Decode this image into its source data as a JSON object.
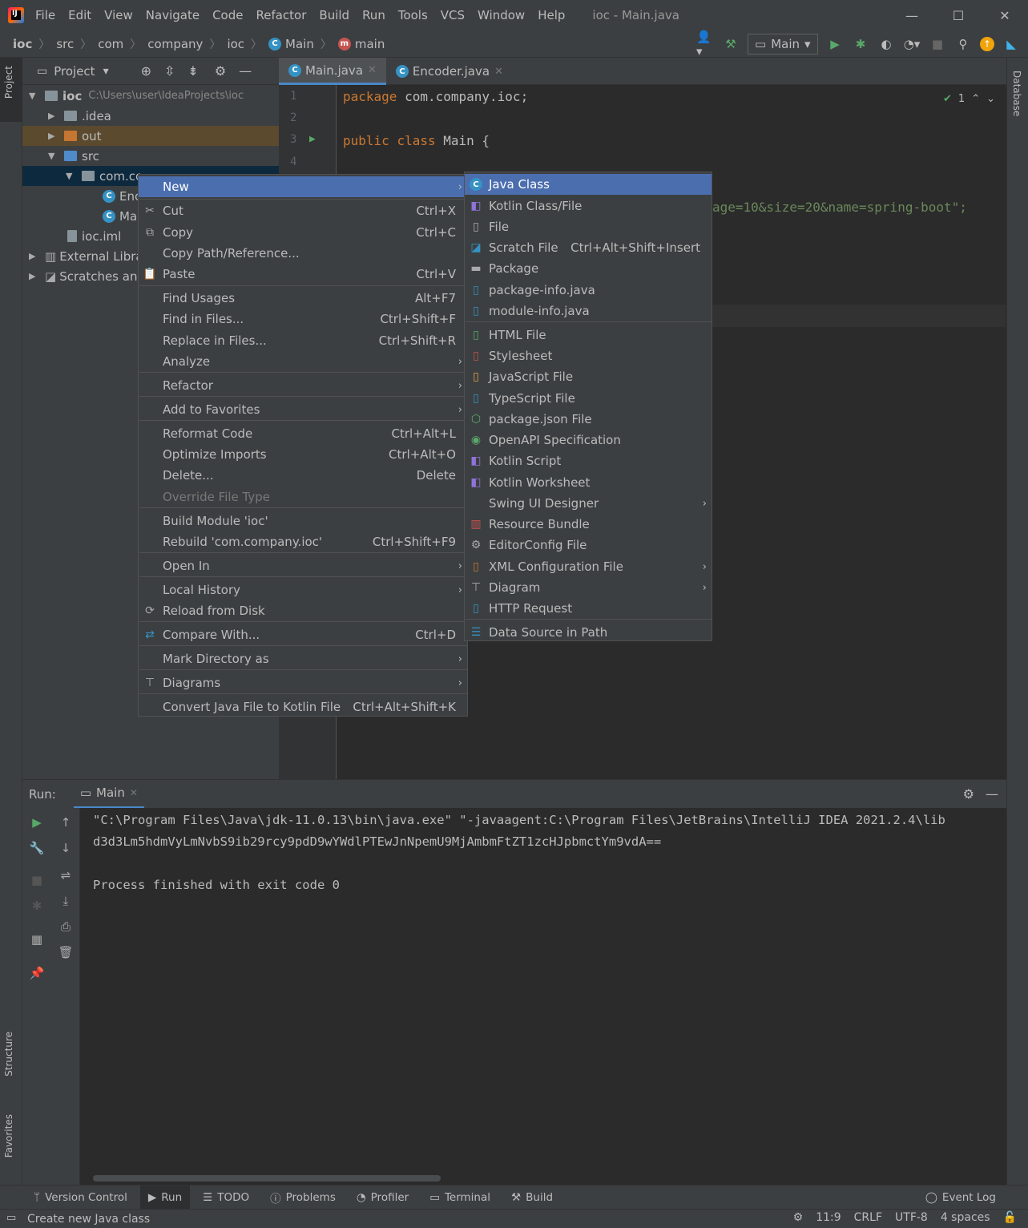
{
  "window": {
    "title": "ioc - Main.java",
    "menu": [
      "File",
      "Edit",
      "View",
      "Navigate",
      "Code",
      "Refactor",
      "Build",
      "Run",
      "Tools",
      "VCS",
      "Window",
      "Help"
    ],
    "controls": {
      "minimize": "—",
      "maximize": "☐",
      "close": "✕"
    }
  },
  "breadcrumb": [
    "ioc",
    "src",
    "com",
    "company",
    "ioc",
    "Main",
    "main"
  ],
  "toolbar": {
    "run_config": "Main"
  },
  "left_stripe": {
    "project": "Project",
    "structure": "Structure",
    "favorites": "Favorites"
  },
  "right_stripe": {
    "database": "Database"
  },
  "project_panel": {
    "title": "Project",
    "tree": [
      {
        "label": "ioc",
        "hint": "C:\\Users\\user\\IdeaProjects\\ioc"
      },
      {
        "label": ".idea"
      },
      {
        "label": "out"
      },
      {
        "label": "src"
      },
      {
        "label": "com.co"
      },
      {
        "label": "Enc"
      },
      {
        "label": "Ma"
      },
      {
        "label": "ioc.iml"
      },
      {
        "label": "External Libra"
      },
      {
        "label": "Scratches anc"
      }
    ]
  },
  "editor": {
    "tabs": [
      {
        "label": "Main.java"
      },
      {
        "label": "Encoder.java"
      }
    ],
    "line_numbers": [
      "1",
      "2",
      "3",
      "4"
    ],
    "code": {
      "l1_kw": "package",
      "l1_rest": " com.company.ioc;",
      "l3_kw1": "public",
      "l3_kw2": "class",
      "l3_rest": " Main {",
      "l_partial": "age=10&size=20&name=spring-boot\";"
    },
    "inspection_count": "1"
  },
  "context_menu": {
    "items": [
      {
        "label": "New",
        "shortcut": ""
      },
      {
        "label": "Cut",
        "shortcut": "Ctrl+X"
      },
      {
        "label": "Copy",
        "shortcut": "Ctrl+C"
      },
      {
        "label": "Copy Path/Reference...",
        "shortcut": ""
      },
      {
        "label": "Paste",
        "shortcut": "Ctrl+V"
      },
      {
        "label": "Find Usages",
        "shortcut": "Alt+F7"
      },
      {
        "label": "Find in Files...",
        "shortcut": "Ctrl+Shift+F"
      },
      {
        "label": "Replace in Files...",
        "shortcut": "Ctrl+Shift+R"
      },
      {
        "label": "Analyze",
        "shortcut": ""
      },
      {
        "label": "Refactor",
        "shortcut": ""
      },
      {
        "label": "Add to Favorites",
        "shortcut": ""
      },
      {
        "label": "Reformat Code",
        "shortcut": "Ctrl+Alt+L"
      },
      {
        "label": "Optimize Imports",
        "shortcut": "Ctrl+Alt+O"
      },
      {
        "label": "Delete...",
        "shortcut": "Delete"
      },
      {
        "label": "Override File Type",
        "shortcut": ""
      },
      {
        "label": "Build Module 'ioc'",
        "shortcut": ""
      },
      {
        "label": "Rebuild 'com.company.ioc'",
        "shortcut": "Ctrl+Shift+F9"
      },
      {
        "label": "Open In",
        "shortcut": ""
      },
      {
        "label": "Local History",
        "shortcut": ""
      },
      {
        "label": "Reload from Disk",
        "shortcut": ""
      },
      {
        "label": "Compare With...",
        "shortcut": "Ctrl+D"
      },
      {
        "label": "Mark Directory as",
        "shortcut": ""
      },
      {
        "label": "Diagrams",
        "shortcut": ""
      },
      {
        "label": "Convert Java File to Kotlin File",
        "shortcut": "Ctrl+Alt+Shift+K"
      }
    ]
  },
  "new_submenu": {
    "items": [
      {
        "label": "Java Class",
        "shortcut": ""
      },
      {
        "label": "Kotlin Class/File",
        "shortcut": ""
      },
      {
        "label": "File",
        "shortcut": ""
      },
      {
        "label": "Scratch File",
        "shortcut": "Ctrl+Alt+Shift+Insert"
      },
      {
        "label": "Package",
        "shortcut": ""
      },
      {
        "label": "package-info.java",
        "shortcut": ""
      },
      {
        "label": "module-info.java",
        "shortcut": ""
      },
      {
        "label": "HTML File",
        "shortcut": ""
      },
      {
        "label": "Stylesheet",
        "shortcut": ""
      },
      {
        "label": "JavaScript File",
        "shortcut": ""
      },
      {
        "label": "TypeScript File",
        "shortcut": ""
      },
      {
        "label": "package.json File",
        "shortcut": ""
      },
      {
        "label": "OpenAPI Specification",
        "shortcut": ""
      },
      {
        "label": "Kotlin Script",
        "shortcut": ""
      },
      {
        "label": "Kotlin Worksheet",
        "shortcut": ""
      },
      {
        "label": "Swing UI Designer",
        "shortcut": ""
      },
      {
        "label": "Resource Bundle",
        "shortcut": ""
      },
      {
        "label": "EditorConfig File",
        "shortcut": ""
      },
      {
        "label": "XML Configuration File",
        "shortcut": ""
      },
      {
        "label": "Diagram",
        "shortcut": ""
      },
      {
        "label": "HTTP Request",
        "shortcut": ""
      },
      {
        "label": "Data Source in Path",
        "shortcut": ""
      }
    ]
  },
  "run_panel": {
    "label": "Run:",
    "tab": "Main",
    "output": [
      "\"C:\\Program Files\\Java\\jdk-11.0.13\\bin\\java.exe\" \"-javaagent:C:\\Program Files\\JetBrains\\IntelliJ IDEA 2021.2.4\\lib",
      "d3d3Lm5hdmVyLmNvbS9ib29rcy9pdD9wYWdlPTEwJnNpemU9MjAmbmFtZT1zcHJpbmctYm9vdA==",
      "",
      "Process finished with exit code 0"
    ]
  },
  "tool_windows": [
    "Version Control",
    "Run",
    "TODO",
    "Problems",
    "Profiler",
    "Terminal",
    "Build",
    "Event Log"
  ],
  "status": {
    "message": "Create new Java class",
    "position": "11:9",
    "line_sep": "CRLF",
    "encoding": "UTF-8",
    "indent": "4 spaces"
  }
}
